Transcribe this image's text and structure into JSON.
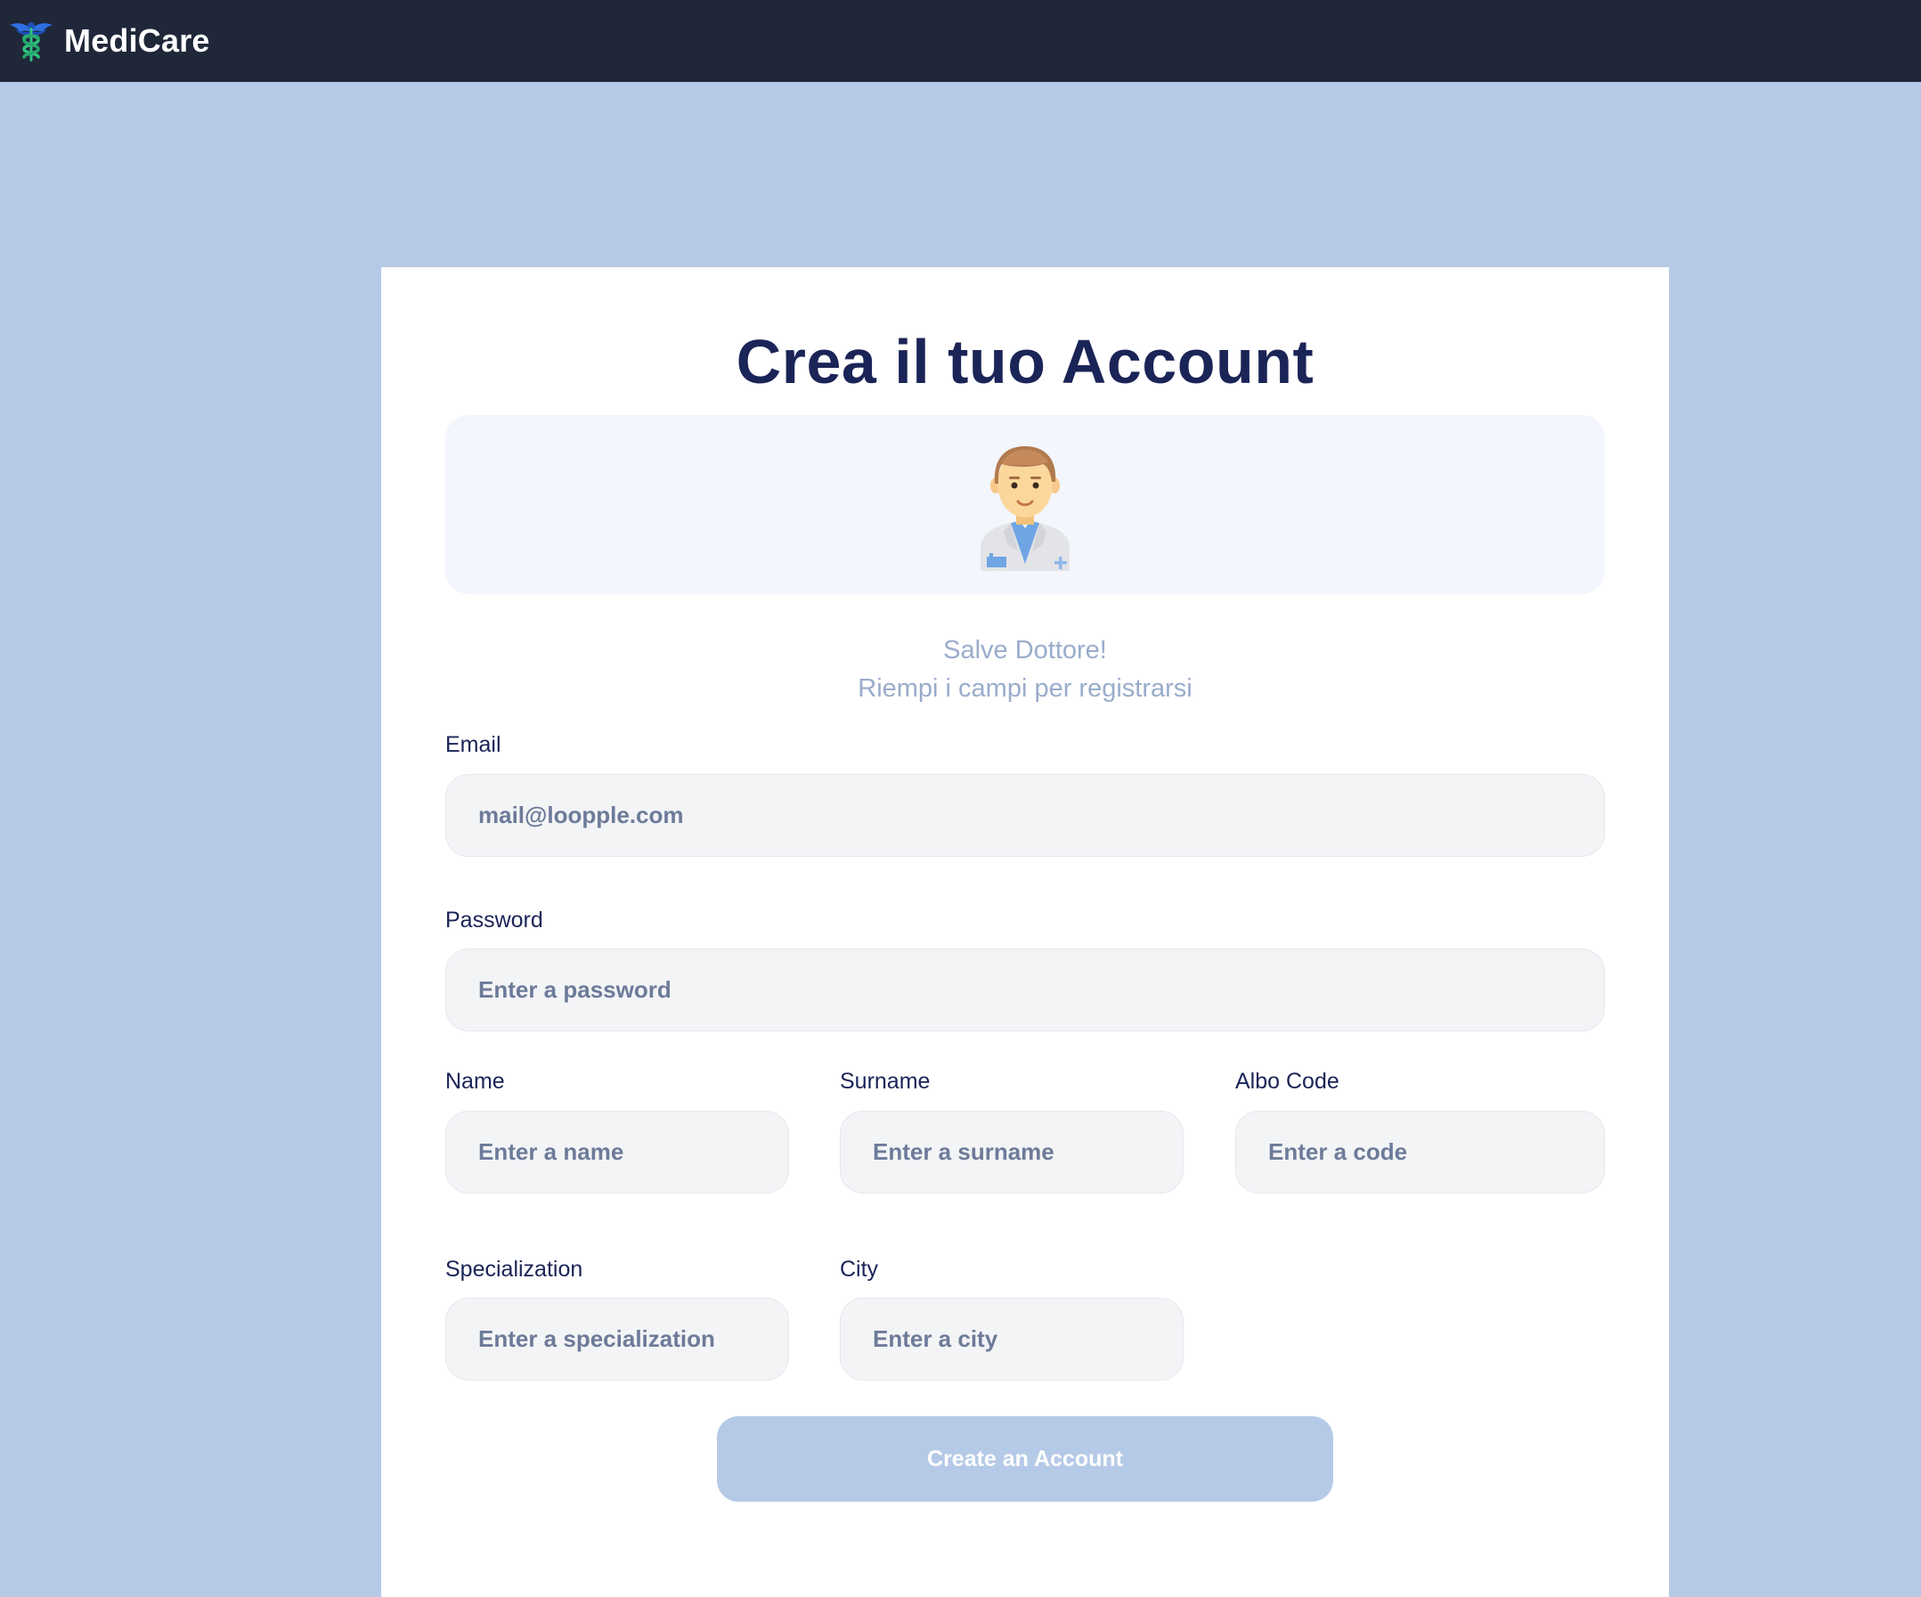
{
  "navbar": {
    "brand_name": "MediCare",
    "logo_icon": "caduceus-icon"
  },
  "form": {
    "title": "Crea il tuo Account",
    "avatar_icon": "doctor-avatar-icon",
    "greeting_line1": "Salve Dottore!",
    "greeting_line2": "Riempi i campi per registrarsi",
    "email": {
      "label": "Email",
      "placeholder": "mail@loopple.com"
    },
    "password": {
      "label": "Password",
      "placeholder": "Enter a password"
    },
    "name": {
      "label": "Name",
      "placeholder": "Enter a name"
    },
    "surname": {
      "label": "Surname",
      "placeholder": "Enter a surname"
    },
    "albo_code": {
      "label": "Albo Code",
      "placeholder": "Enter a code"
    },
    "specialization": {
      "label": "Specialization",
      "placeholder": "Enter a specialization"
    },
    "city": {
      "label": "City",
      "placeholder": "Enter a city"
    },
    "submit_label": "Create an Account"
  },
  "colors": {
    "navbar_bg": "#1f2739",
    "page_bg": "#b5cae7",
    "title_color": "#1b2457",
    "button_bg": "#b5cae7",
    "field_bg": "#f3f4f6"
  }
}
